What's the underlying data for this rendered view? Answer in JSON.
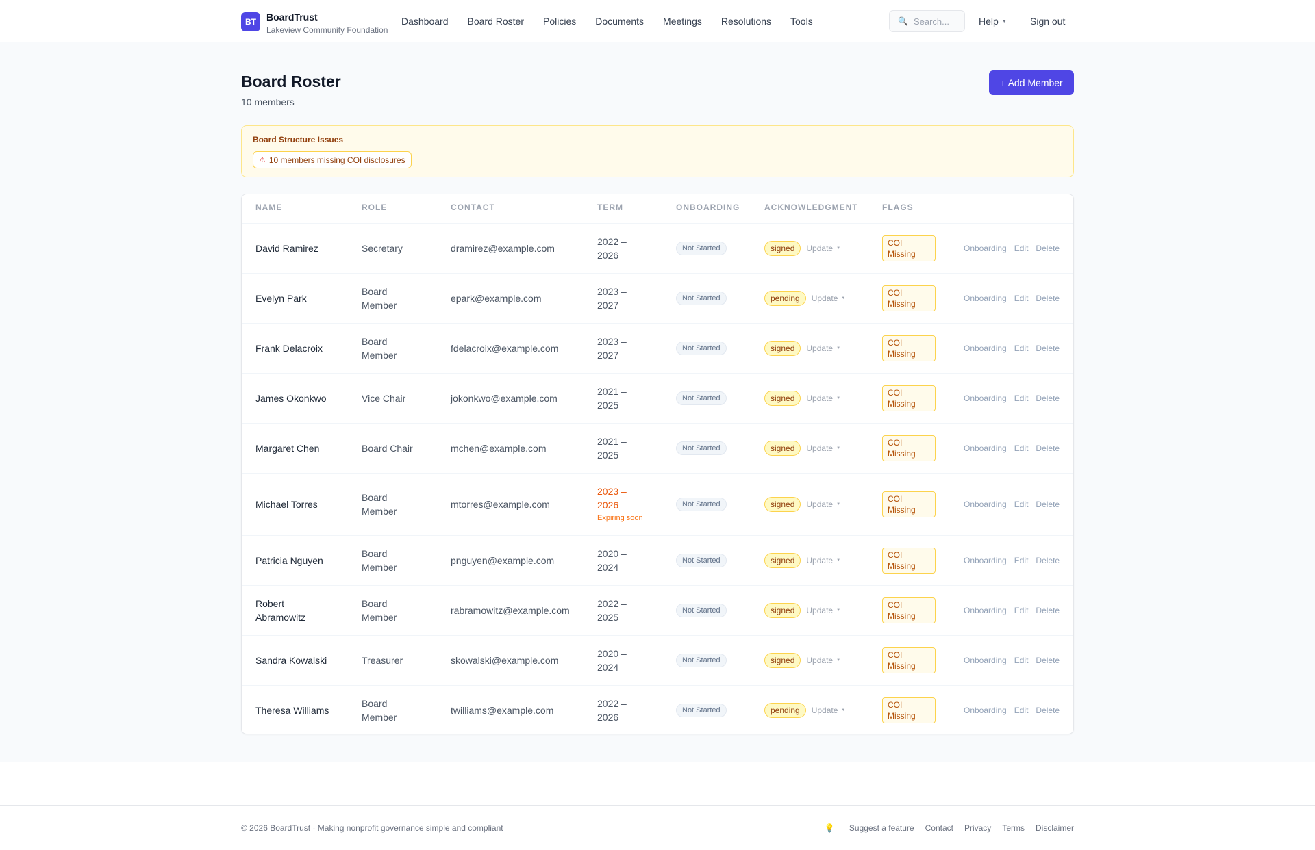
{
  "header": {
    "logo_initials": "BT",
    "brand": "BoardTrust",
    "org": "Lakeview Community Foundation",
    "nav": [
      "Dashboard",
      "Board Roster",
      "Policies",
      "Documents",
      "Meetings",
      "Resolutions",
      "Tools"
    ],
    "search_placeholder": "Search...",
    "help": "Help",
    "signout": "Sign out"
  },
  "page": {
    "title": "Board Roster",
    "count": "10 members",
    "add_button": "+ Add Member"
  },
  "alert": {
    "title": "Board Structure Issues",
    "chip": "10 members missing COI disclosures"
  },
  "table": {
    "headers": [
      "NAME",
      "ROLE",
      "CONTACT",
      "TERM",
      "ONBOARDING",
      "ACKNOWLEDGMENT",
      "FLAGS"
    ],
    "update_label": "Update",
    "actions": [
      "Onboarding",
      "Edit",
      "Delete"
    ],
    "rows": [
      {
        "name": [
          "David Ramirez"
        ],
        "role": [
          "Secretary"
        ],
        "contact": "dramirez@example.com",
        "term": [
          "2022 –",
          "2026"
        ],
        "onboarding": "Not Started",
        "ack": "signed",
        "flag": [
          "COI",
          "Missing"
        ]
      },
      {
        "name": [
          "Evelyn Park"
        ],
        "role": [
          "Board",
          "Member"
        ],
        "contact": "epark@example.com",
        "term": [
          "2023 –",
          "2027"
        ],
        "onboarding": "Not Started",
        "ack": "pending",
        "flag": [
          "COI",
          "Missing"
        ]
      },
      {
        "name": [
          "Frank Delacroix"
        ],
        "role": [
          "Board",
          "Member"
        ],
        "contact": "fdelacroix@example.com",
        "term": [
          "2023 –",
          "2027"
        ],
        "onboarding": "Not Started",
        "ack": "signed",
        "flag": [
          "COI",
          "Missing"
        ]
      },
      {
        "name": [
          "James Okonkwo"
        ],
        "role": [
          "Vice Chair"
        ],
        "contact": "jokonkwo@example.com",
        "term": [
          "2021 –",
          "2025"
        ],
        "onboarding": "Not Started",
        "ack": "signed",
        "flag": [
          "COI",
          "Missing"
        ]
      },
      {
        "name": [
          "Margaret Chen"
        ],
        "role": [
          "Board Chair"
        ],
        "contact": "mchen@example.com",
        "term": [
          "2021 –",
          "2025"
        ],
        "onboarding": "Not Started",
        "ack": "signed",
        "flag": [
          "COI",
          "Missing"
        ]
      },
      {
        "name": [
          "Michael Torres"
        ],
        "role": [
          "Board",
          "Member"
        ],
        "contact": "mtorres@example.com",
        "term": [
          "2023 –",
          "2026"
        ],
        "term_note": "Expiring soon",
        "onboarding": "Not Started",
        "ack": "signed",
        "flag": [
          "COI",
          "Missing"
        ]
      },
      {
        "name": [
          "Patricia Nguyen"
        ],
        "role": [
          "Board",
          "Member"
        ],
        "contact": "pnguyen@example.com",
        "term": [
          "2020 –",
          "2024"
        ],
        "onboarding": "Not Started",
        "ack": "signed",
        "flag": [
          "COI",
          "Missing"
        ]
      },
      {
        "name": [
          "Robert",
          "Abramowitz"
        ],
        "role": [
          "Board",
          "Member"
        ],
        "contact": "rabramowitz@example.com",
        "term": [
          "2022 –",
          "2025"
        ],
        "onboarding": "Not Started",
        "ack": "signed",
        "flag": [
          "COI",
          "Missing"
        ]
      },
      {
        "name": [
          "Sandra Kowalski"
        ],
        "role": [
          "Treasurer"
        ],
        "contact": "skowalski@example.com",
        "term": [
          "2020 –",
          "2024"
        ],
        "onboarding": "Not Started",
        "ack": "signed",
        "flag": [
          "COI",
          "Missing"
        ]
      },
      {
        "name": [
          "Theresa Williams"
        ],
        "role": [
          "Board",
          "Member"
        ],
        "contact": "twilliams@example.com",
        "term": [
          "2022 –",
          "2026"
        ],
        "onboarding": "Not Started",
        "ack": "pending",
        "flag": [
          "COI",
          "Missing"
        ]
      }
    ]
  },
  "footer": {
    "left": "© 2026 BoardTrust · Making nonprofit governance simple and compliant",
    "links": [
      "Suggest a feature",
      "Contact",
      "Privacy",
      "Terms",
      "Disclaimer"
    ]
  },
  "colors": {
    "accent": "#4f46e5",
    "warning_bg": "#fffbeb",
    "warning_border": "#fcd34d",
    "expiring": "#ea580c"
  }
}
